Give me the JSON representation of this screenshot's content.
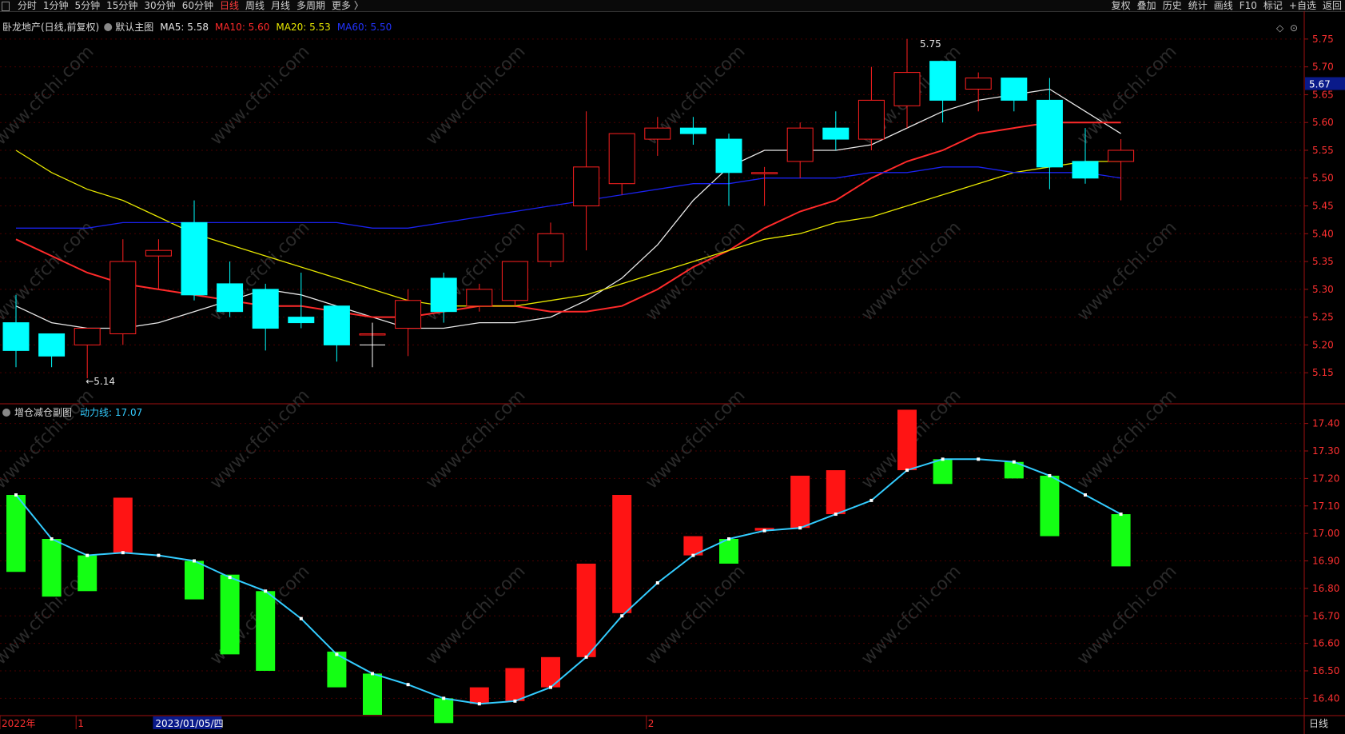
{
  "toolbar": {
    "left_items": [
      "分时",
      "1分钟",
      "5分钟",
      "15分钟",
      "30分钟",
      "60分钟",
      "日线",
      "周线",
      "月线",
      "多周期",
      "更多 〉"
    ],
    "active": "日线",
    "right_items": [
      "复权",
      "叠加",
      "历史",
      "统计",
      "画线",
      "F10",
      "标记",
      "+自选",
      "返回"
    ]
  },
  "main_panel": {
    "title": "卧龙地产(日线,前复权)",
    "template": "默认主图",
    "ma_labels": [
      {
        "text": "MA5: 5.58",
        "color": "#e8e8e8"
      },
      {
        "text": "MA10: 5.60",
        "color": "#ff2a2a"
      },
      {
        "text": "MA20: 5.53",
        "color": "#e6e600"
      },
      {
        "text": "MA60: 5.50",
        "color": "#2233ff"
      }
    ],
    "high_label": "5.75",
    "low_label": "5.14",
    "price_tag": "5.67"
  },
  "sub_panel": {
    "title": "增仓减仓副图",
    "line_label": "动力线: 17.07"
  },
  "x_axis": {
    "labels": [
      {
        "text": "2022年",
        "index": 0
      },
      {
        "text": "1",
        "index": 2
      },
      {
        "text": "2",
        "index": 18
      }
    ],
    "cursor_label": "2023/01/05/四",
    "cursor_index": 4,
    "period_label": "日线"
  },
  "watermark": "www.cfchi.com",
  "colors": {
    "up": "#ff2020",
    "down": "#00ffff",
    "bar_up": "#ff1414",
    "bar_down": "#14ff14",
    "line": "#33ccff"
  },
  "chart_data": [
    {
      "type": "candlestick",
      "title": "卧龙地产(日线,前复权)",
      "y_ticks": [
        5.15,
        5.2,
        5.25,
        5.3,
        5.35,
        5.4,
        5.45,
        5.5,
        5.55,
        5.6,
        5.65,
        5.7,
        5.75
      ],
      "ylim": [
        5.11,
        5.78
      ],
      "candles": [
        {
          "o": 5.24,
          "h": 5.29,
          "l": 5.16,
          "c": 5.19
        },
        {
          "o": 5.22,
          "h": 5.22,
          "l": 5.16,
          "c": 5.18
        },
        {
          "o": 5.2,
          "h": 5.23,
          "l": 5.14,
          "c": 5.23
        },
        {
          "o": 5.22,
          "h": 5.39,
          "l": 5.2,
          "c": 5.35
        },
        {
          "o": 5.36,
          "h": 5.39,
          "l": 5.3,
          "c": 5.37
        },
        {
          "o": 5.42,
          "h": 5.46,
          "l": 5.28,
          "c": 5.29
        },
        {
          "o": 5.31,
          "h": 5.35,
          "l": 5.25,
          "c": 5.26
        },
        {
          "o": 5.3,
          "h": 5.31,
          "l": 5.19,
          "c": 5.23
        },
        {
          "o": 5.25,
          "h": 5.33,
          "l": 5.23,
          "c": 5.24
        },
        {
          "o": 5.27,
          "h": 5.27,
          "l": 5.17,
          "c": 5.2
        },
        {
          "o": 5.22,
          "h": 5.24,
          "l": 5.17,
          "c": 5.22
        },
        {
          "o": 5.23,
          "h": 5.3,
          "l": 5.18,
          "c": 5.28
        },
        {
          "o": 5.32,
          "h": 5.33,
          "l": 5.24,
          "c": 5.26
        },
        {
          "o": 5.27,
          "h": 5.31,
          "l": 5.26,
          "c": 5.3
        },
        {
          "o": 5.28,
          "h": 5.35,
          "l": 5.27,
          "c": 5.35
        },
        {
          "o": 5.35,
          "h": 5.42,
          "l": 5.34,
          "c": 5.4
        },
        {
          "o": 5.45,
          "h": 5.62,
          "l": 5.37,
          "c": 5.52
        },
        {
          "o": 5.49,
          "h": 5.58,
          "l": 5.47,
          "c": 5.58
        },
        {
          "o": 5.57,
          "h": 5.61,
          "l": 5.54,
          "c": 5.59
        },
        {
          "o": 5.59,
          "h": 5.61,
          "l": 5.56,
          "c": 5.58
        },
        {
          "o": 5.57,
          "h": 5.58,
          "l": 5.45,
          "c": 5.51
        },
        {
          "o": 5.51,
          "h": 5.52,
          "l": 5.45,
          "c": 5.51
        },
        {
          "o": 5.53,
          "h": 5.6,
          "l": 5.5,
          "c": 5.59
        },
        {
          "o": 5.59,
          "h": 5.62,
          "l": 5.55,
          "c": 5.57
        },
        {
          "o": 5.57,
          "h": 5.7,
          "l": 5.55,
          "c": 5.64
        },
        {
          "o": 5.63,
          "h": 5.75,
          "l": 5.59,
          "c": 5.69
        },
        {
          "o": 5.71,
          "h": 5.71,
          "l": 5.6,
          "c": 5.64
        },
        {
          "o": 5.66,
          "h": 5.69,
          "l": 5.62,
          "c": 5.68
        },
        {
          "o": 5.68,
          "h": 5.68,
          "l": 5.62,
          "c": 5.64
        },
        {
          "o": 5.64,
          "h": 5.68,
          "l": 5.48,
          "c": 5.52
        },
        {
          "o": 5.53,
          "h": 5.59,
          "l": 5.49,
          "c": 5.5
        },
        {
          "o": 5.53,
          "h": 5.57,
          "l": 5.46,
          "c": 5.55
        }
      ],
      "ma": [
        {
          "name": "MA5",
          "color": "#e8e8e8",
          "values": [
            5.27,
            5.24,
            5.23,
            5.23,
            5.24,
            5.26,
            5.28,
            5.3,
            5.29,
            5.27,
            5.25,
            5.23,
            5.23,
            5.24,
            5.24,
            5.25,
            5.28,
            5.32,
            5.38,
            5.46,
            5.52,
            5.55,
            5.55,
            5.55,
            5.56,
            5.59,
            5.62,
            5.64,
            5.65,
            5.66,
            5.62,
            5.58
          ]
        },
        {
          "name": "MA10",
          "color": "#ff2a2a",
          "values": [
            5.39,
            5.36,
            5.33,
            5.31,
            5.3,
            5.29,
            5.28,
            5.27,
            5.27,
            5.26,
            5.25,
            5.25,
            5.26,
            5.27,
            5.27,
            5.26,
            5.26,
            5.27,
            5.3,
            5.34,
            5.37,
            5.41,
            5.44,
            5.46,
            5.5,
            5.53,
            5.55,
            5.58,
            5.59,
            5.6,
            5.6,
            5.6
          ]
        },
        {
          "name": "MA20",
          "color": "#e6e600",
          "values": [
            5.55,
            5.51,
            5.48,
            5.46,
            5.43,
            5.4,
            5.38,
            5.36,
            5.34,
            5.32,
            5.3,
            5.28,
            5.27,
            5.27,
            5.27,
            5.28,
            5.29,
            5.31,
            5.33,
            5.35,
            5.37,
            5.39,
            5.4,
            5.42,
            5.43,
            5.45,
            5.47,
            5.49,
            5.51,
            5.52,
            5.53,
            5.53
          ]
        },
        {
          "name": "MA60",
          "color": "#1a22ee",
          "values": [
            5.41,
            5.41,
            5.41,
            5.42,
            5.42,
            5.42,
            5.42,
            5.42,
            5.42,
            5.42,
            5.41,
            5.41,
            5.42,
            5.43,
            5.44,
            5.45,
            5.46,
            5.47,
            5.48,
            5.49,
            5.49,
            5.5,
            5.5,
            5.5,
            5.51,
            5.51,
            5.52,
            5.52,
            5.51,
            5.51,
            5.51,
            5.5
          ]
        }
      ]
    },
    {
      "type": "bar",
      "title": "增仓减仓副图",
      "y_ticks": [
        16.4,
        16.5,
        16.6,
        16.7,
        16.8,
        16.9,
        17.0,
        17.1,
        17.2,
        17.3,
        17.4
      ],
      "ylim": [
        16.34,
        17.46
      ],
      "series": [
        {
          "name": "动力线",
          "type": "line",
          "values": [
            17.14,
            16.98,
            16.92,
            16.93,
            16.92,
            16.9,
            16.84,
            16.79,
            16.69,
            16.56,
            16.49,
            16.45,
            16.4,
            16.38,
            16.39,
            16.44,
            16.55,
            16.7,
            16.82,
            16.92,
            16.98,
            17.01,
            17.02,
            17.07,
            17.12,
            17.23,
            17.27,
            17.27,
            17.26,
            17.21,
            17.14,
            17.07
          ]
        },
        {
          "name": "bars",
          "type": "bar",
          "values": [
            [
              17.14,
              16.86
            ],
            [
              16.98,
              16.77
            ],
            [
              16.92,
              16.79
            ],
            [
              16.93,
              17.13
            ],
            [
              16.9,
              16.76
            ],
            [
              16.85,
              16.56
            ],
            [
              16.79,
              16.5
            ],
            [
              16.57,
              16.44
            ],
            [
              16.49,
              16.34
            ],
            [
              16.4,
              16.31
            ],
            [
              16.38,
              16.44
            ],
            [
              16.39,
              16.51
            ],
            [
              16.44,
              16.55
            ],
            [
              16.55,
              16.89
            ],
            [
              16.71,
              17.14
            ],
            [
              16.92,
              16.99
            ],
            [
              16.98,
              16.89
            ],
            [
              17.01,
              17.02
            ],
            [
              17.02,
              17.21
            ],
            [
              17.07,
              17.23
            ],
            [
              17.23,
              17.45
            ],
            [
              17.27,
              17.18
            ],
            [
              17.26,
              17.2
            ],
            [
              17.21,
              16.99
            ],
            [
              17.07,
              16.88
            ]
          ]
        }
      ]
    }
  ]
}
